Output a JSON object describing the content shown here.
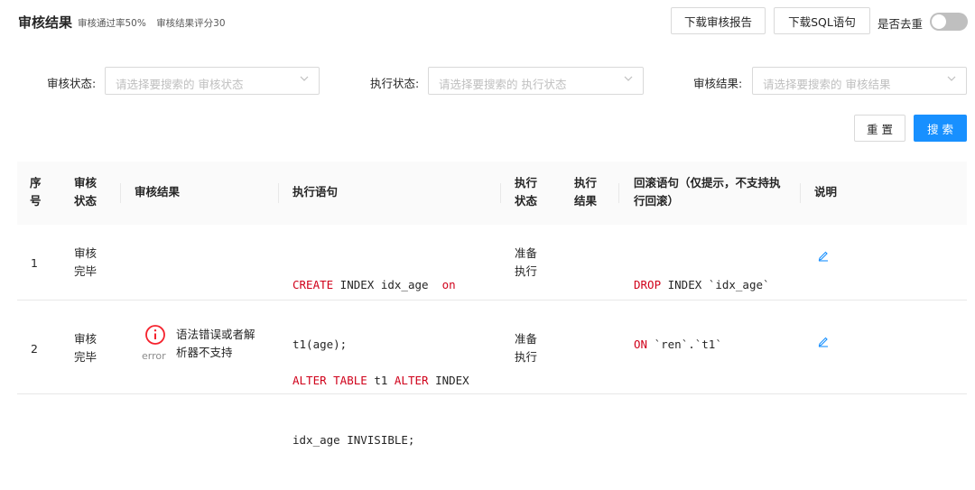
{
  "header": {
    "title": "审核结果",
    "pass_rate": "审核通过率50%",
    "score": "审核结果评分30",
    "download_report": "下载审核报告",
    "download_sql": "下载SQL语句",
    "dedup_label": "是否去重",
    "dedup_on": false
  },
  "filters": {
    "audit_status": {
      "label": "审核状态:",
      "placeholder": "请选择要搜索的 审核状态"
    },
    "exec_status": {
      "label": "执行状态:",
      "placeholder": "请选择要搜索的 执行状态"
    },
    "audit_result": {
      "label": "审核结果:",
      "placeholder": "请选择要搜索的 审核结果"
    },
    "reset": "重 置",
    "search": "搜 索"
  },
  "colors": {
    "primary": "#1890ff",
    "keyword": "#d0021b",
    "error": "#f5222d"
  },
  "table": {
    "headers": {
      "no_1": "序",
      "no_2": "号",
      "status_1": "审核",
      "status_2": "状态",
      "result": "审核结果",
      "sql": "执行语句",
      "exec_status_1": "执行",
      "exec_status_2": "状态",
      "exec_result_1": "执行",
      "exec_result_2": "结果",
      "rollback_1": "回滚语句（仅提示，不支持执",
      "rollback_2": "行回滚）",
      "note": "说明"
    },
    "rows": [
      {
        "no": "1",
        "status_1": "审核",
        "status_2": "完毕",
        "sql_kw1": "CREATE",
        "sql_t1": " INDEX idx_age ",
        "sql_kw2": "on",
        "sql_line2": "t1(age);",
        "exec_1": "准备",
        "exec_2": "执行",
        "rb_kw1": "DROP",
        "rb_t1": " INDEX `idx_age`",
        "rb_kw2": "ON",
        "rb_t2": " `ren`.`t1`",
        "edit_icon": "edit-icon"
      },
      {
        "no": "2",
        "status_1": "审核",
        "status_2": "完毕",
        "result_icon": "error-circle-icon",
        "result_level": "error",
        "result_1": "语法错误或者解",
        "result_2": "析器不支持",
        "sql_kw1": "ALTER TABLE",
        "sql_t1": " t1 ",
        "sql_kw2": "ALTER",
        "sql_t2": " INDEX",
        "sql_line2": "idx_age INVISIBLE;",
        "exec_1": "准备",
        "exec_2": "执行",
        "edit_icon": "edit-icon"
      }
    ]
  }
}
